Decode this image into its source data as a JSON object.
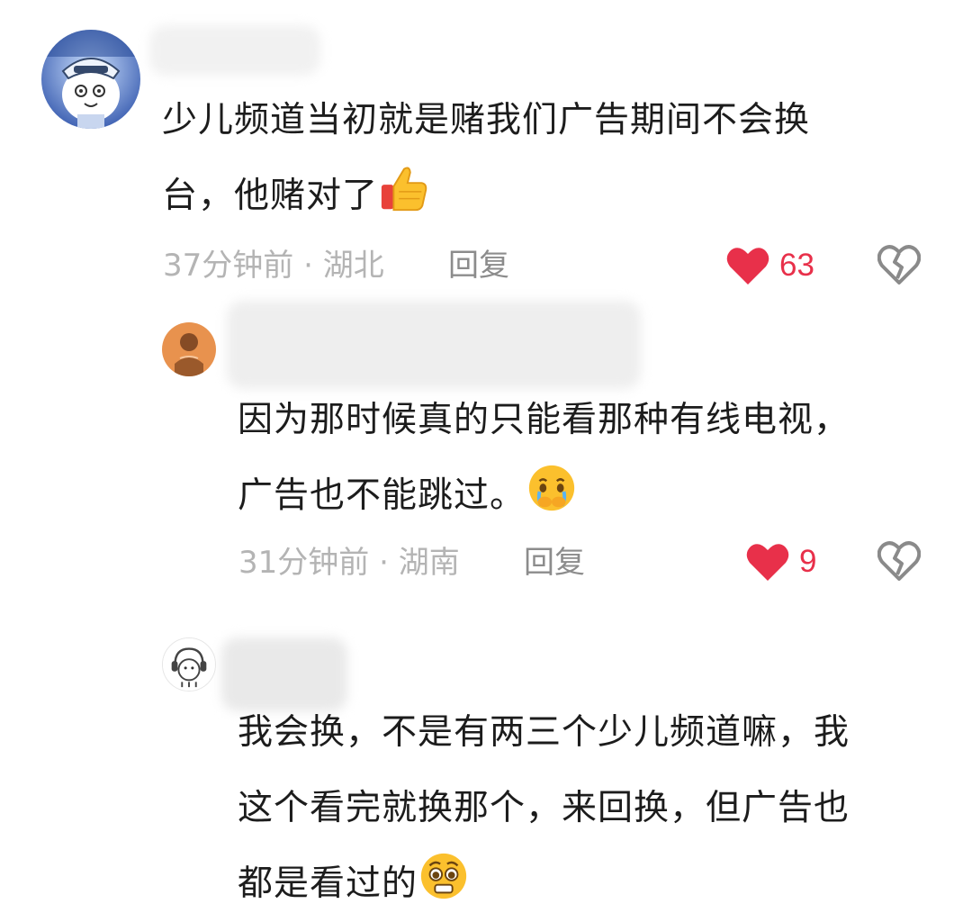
{
  "comments": [
    {
      "avatar_icon": "cartoon-avatar-icon",
      "text_lines": [
        "少儿频道当初就是赌我们广告期间不会换",
        "台，他赌对了"
      ],
      "emoji": "thumbs-up-emoji",
      "time": "37分钟前",
      "location": "湖北",
      "meta_separator": " · ",
      "reply_label": "回复",
      "likes": "63",
      "like_color": "#e8304a"
    },
    {
      "avatar_icon": "orange-avatar-icon",
      "text_lines": [
        "因为那时候真的只能看那种有线电视，",
        "广告也不能跳过。"
      ],
      "emoji": "crying-emoji",
      "time": "31分钟前",
      "location": "湖南",
      "meta_separator": " · ",
      "reply_label": "回复",
      "likes": "9",
      "like_color": "#e8304a"
    },
    {
      "avatar_icon": "cat-headphones-avatar-icon",
      "text_lines": [
        "我会换，不是有两三个少儿频道嘛，我",
        "这个看完就换那个，来回换，但广告也",
        "都是看过的"
      ],
      "emoji": "pleading-emoji"
    }
  ]
}
